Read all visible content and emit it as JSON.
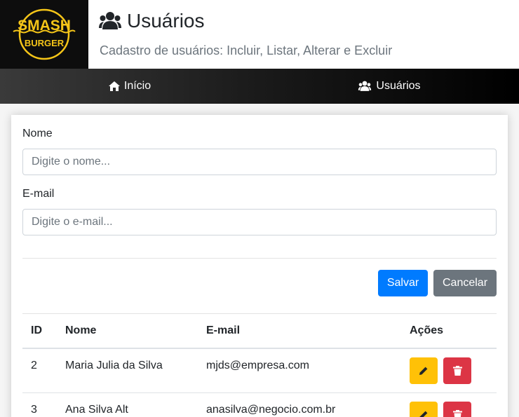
{
  "brand": {
    "logo_top": "SMASH",
    "logo_bottom": "BURGER"
  },
  "header": {
    "title": "Usuários",
    "subtitle": "Cadastro de usuários: Incluir, Listar, Alterar e Excluir"
  },
  "nav": {
    "home": "Início",
    "users": "Usuários"
  },
  "form": {
    "name_label": "Nome",
    "name_placeholder": "Digite o nome...",
    "email_label": "E-mail",
    "email_placeholder": "Digite o e-mail...",
    "save": "Salvar",
    "cancel": "Cancelar"
  },
  "table": {
    "headers": {
      "id": "ID",
      "name": "Nome",
      "email": "E-mail",
      "actions": "Ações"
    },
    "rows": [
      {
        "id": "2",
        "name": "Maria Julia da Silva",
        "email": "mjds@empresa.com"
      },
      {
        "id": "3",
        "name": "Ana Silva Alt",
        "email": "anasilva@negocio.com.br"
      }
    ]
  },
  "colors": {
    "primary": "#007bff",
    "secondary": "#6c757d",
    "warning": "#ffc107",
    "danger": "#dc3545",
    "logo_yellow": "#f5c518"
  },
  "icons": {
    "title": "users-icon",
    "home": "home-icon",
    "users": "users-icon",
    "edit": "pencil-icon",
    "delete": "trash-icon"
  }
}
